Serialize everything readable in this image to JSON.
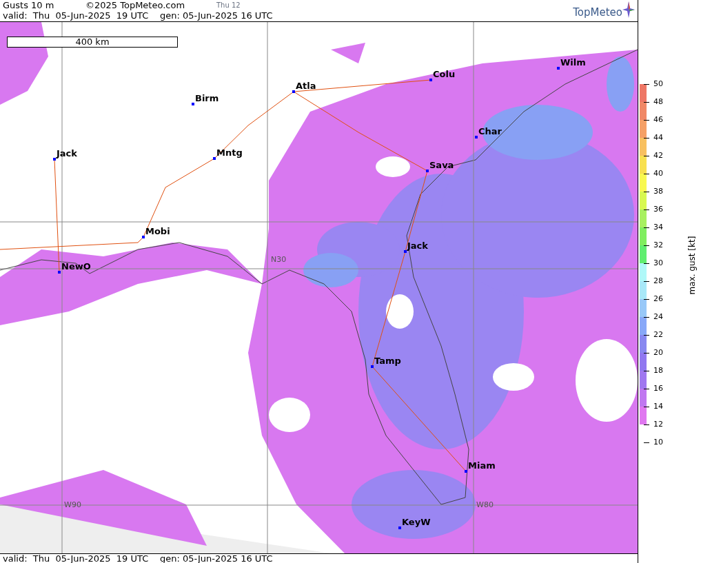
{
  "header": {
    "title": "Gusts 10 m",
    "copyright": "©2025 TopMeteo.com",
    "day": "Thu 12",
    "valid": "valid:  Thu  05-Jun-2025  19 UTC",
    "gen": "gen: 05-Jun-2025 16 UTC"
  },
  "logo": {
    "text": "TopMeteo"
  },
  "map": {
    "scale": "400 km",
    "cities": [
      {
        "name": "Wilm"
      },
      {
        "name": "Colu"
      },
      {
        "name": "Atla"
      },
      {
        "name": "Birm"
      },
      {
        "name": "Char"
      },
      {
        "name": "Jack"
      },
      {
        "name": "Mntg"
      },
      {
        "name": "Sava"
      },
      {
        "name": "Mobi"
      },
      {
        "name": "Jack"
      },
      {
        "name": "NewO"
      },
      {
        "name": "Tamp"
      },
      {
        "name": "Miam"
      },
      {
        "name": "KeyW"
      }
    ],
    "grid_labels": [
      "N30",
      "W90",
      "W80"
    ]
  },
  "colorbar": {
    "label": "max. gust [kt]",
    "ticks": [
      "50",
      "48",
      "46",
      "44",
      "42",
      "40",
      "38",
      "36",
      "34",
      "32",
      "30",
      "28",
      "26",
      "24",
      "22",
      "20",
      "18",
      "16",
      "14",
      "12",
      "10"
    ]
  },
  "footer": {
    "valid": "valid:  Thu  05-Jun-2025  19 UTC",
    "gen": "gen: 05-Jun-2025 16 UTC"
  }
}
